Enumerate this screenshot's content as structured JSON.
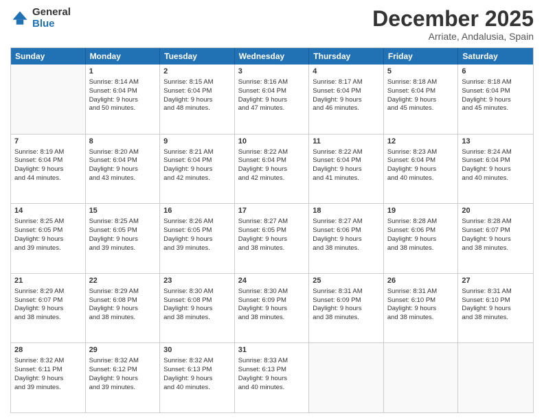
{
  "logo": {
    "line1": "General",
    "line2": "Blue"
  },
  "title": "December 2025",
  "subtitle": "Arriate, Andalusia, Spain",
  "days": [
    "Sunday",
    "Monday",
    "Tuesday",
    "Wednesday",
    "Thursday",
    "Friday",
    "Saturday"
  ],
  "weeks": [
    [
      {
        "day": "",
        "info": ""
      },
      {
        "day": "1",
        "info": "Sunrise: 8:14 AM\nSunset: 6:04 PM\nDaylight: 9 hours\nand 50 minutes."
      },
      {
        "day": "2",
        "info": "Sunrise: 8:15 AM\nSunset: 6:04 PM\nDaylight: 9 hours\nand 48 minutes."
      },
      {
        "day": "3",
        "info": "Sunrise: 8:16 AM\nSunset: 6:04 PM\nDaylight: 9 hours\nand 47 minutes."
      },
      {
        "day": "4",
        "info": "Sunrise: 8:17 AM\nSunset: 6:04 PM\nDaylight: 9 hours\nand 46 minutes."
      },
      {
        "day": "5",
        "info": "Sunrise: 8:18 AM\nSunset: 6:04 PM\nDaylight: 9 hours\nand 45 minutes."
      },
      {
        "day": "6",
        "info": "Sunrise: 8:18 AM\nSunset: 6:04 PM\nDaylight: 9 hours\nand 45 minutes."
      }
    ],
    [
      {
        "day": "7",
        "info": "Sunrise: 8:19 AM\nSunset: 6:04 PM\nDaylight: 9 hours\nand 44 minutes."
      },
      {
        "day": "8",
        "info": "Sunrise: 8:20 AM\nSunset: 6:04 PM\nDaylight: 9 hours\nand 43 minutes."
      },
      {
        "day": "9",
        "info": "Sunrise: 8:21 AM\nSunset: 6:04 PM\nDaylight: 9 hours\nand 42 minutes."
      },
      {
        "day": "10",
        "info": "Sunrise: 8:22 AM\nSunset: 6:04 PM\nDaylight: 9 hours\nand 42 minutes."
      },
      {
        "day": "11",
        "info": "Sunrise: 8:22 AM\nSunset: 6:04 PM\nDaylight: 9 hours\nand 41 minutes."
      },
      {
        "day": "12",
        "info": "Sunrise: 8:23 AM\nSunset: 6:04 PM\nDaylight: 9 hours\nand 40 minutes."
      },
      {
        "day": "13",
        "info": "Sunrise: 8:24 AM\nSunset: 6:04 PM\nDaylight: 9 hours\nand 40 minutes."
      }
    ],
    [
      {
        "day": "14",
        "info": "Sunrise: 8:25 AM\nSunset: 6:05 PM\nDaylight: 9 hours\nand 39 minutes."
      },
      {
        "day": "15",
        "info": "Sunrise: 8:25 AM\nSunset: 6:05 PM\nDaylight: 9 hours\nand 39 minutes."
      },
      {
        "day": "16",
        "info": "Sunrise: 8:26 AM\nSunset: 6:05 PM\nDaylight: 9 hours\nand 39 minutes."
      },
      {
        "day": "17",
        "info": "Sunrise: 8:27 AM\nSunset: 6:05 PM\nDaylight: 9 hours\nand 38 minutes."
      },
      {
        "day": "18",
        "info": "Sunrise: 8:27 AM\nSunset: 6:06 PM\nDaylight: 9 hours\nand 38 minutes."
      },
      {
        "day": "19",
        "info": "Sunrise: 8:28 AM\nSunset: 6:06 PM\nDaylight: 9 hours\nand 38 minutes."
      },
      {
        "day": "20",
        "info": "Sunrise: 8:28 AM\nSunset: 6:07 PM\nDaylight: 9 hours\nand 38 minutes."
      }
    ],
    [
      {
        "day": "21",
        "info": "Sunrise: 8:29 AM\nSunset: 6:07 PM\nDaylight: 9 hours\nand 38 minutes."
      },
      {
        "day": "22",
        "info": "Sunrise: 8:29 AM\nSunset: 6:08 PM\nDaylight: 9 hours\nand 38 minutes."
      },
      {
        "day": "23",
        "info": "Sunrise: 8:30 AM\nSunset: 6:08 PM\nDaylight: 9 hours\nand 38 minutes."
      },
      {
        "day": "24",
        "info": "Sunrise: 8:30 AM\nSunset: 6:09 PM\nDaylight: 9 hours\nand 38 minutes."
      },
      {
        "day": "25",
        "info": "Sunrise: 8:31 AM\nSunset: 6:09 PM\nDaylight: 9 hours\nand 38 minutes."
      },
      {
        "day": "26",
        "info": "Sunrise: 8:31 AM\nSunset: 6:10 PM\nDaylight: 9 hours\nand 38 minutes."
      },
      {
        "day": "27",
        "info": "Sunrise: 8:31 AM\nSunset: 6:10 PM\nDaylight: 9 hours\nand 38 minutes."
      }
    ],
    [
      {
        "day": "28",
        "info": "Sunrise: 8:32 AM\nSunset: 6:11 PM\nDaylight: 9 hours\nand 39 minutes."
      },
      {
        "day": "29",
        "info": "Sunrise: 8:32 AM\nSunset: 6:12 PM\nDaylight: 9 hours\nand 39 minutes."
      },
      {
        "day": "30",
        "info": "Sunrise: 8:32 AM\nSunset: 6:13 PM\nDaylight: 9 hours\nand 40 minutes."
      },
      {
        "day": "31",
        "info": "Sunrise: 8:33 AM\nSunset: 6:13 PM\nDaylight: 9 hours\nand 40 minutes."
      },
      {
        "day": "",
        "info": ""
      },
      {
        "day": "",
        "info": ""
      },
      {
        "day": "",
        "info": ""
      }
    ]
  ]
}
